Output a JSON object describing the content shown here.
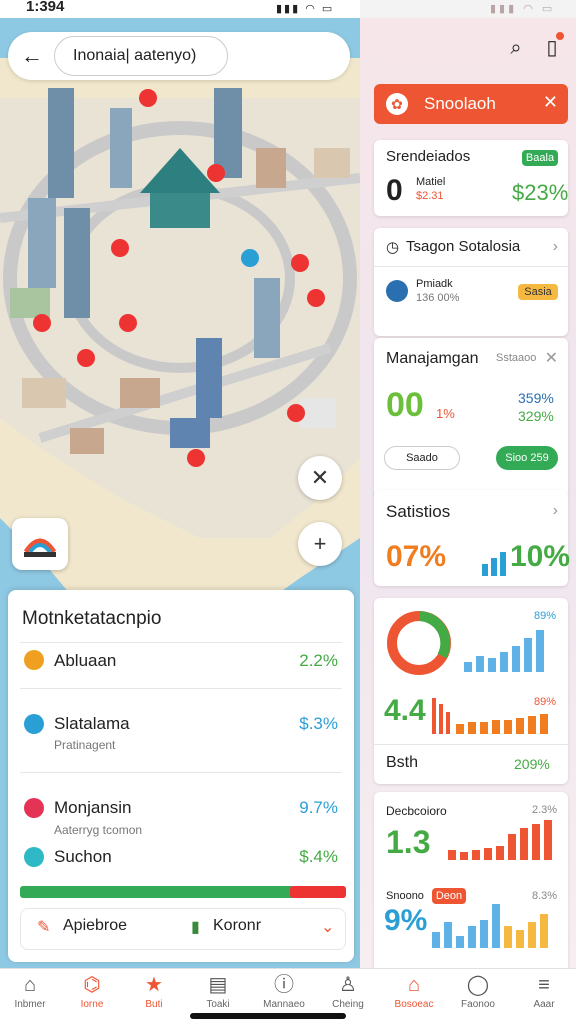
{
  "status": {
    "time": "1:394"
  },
  "search": {
    "query": "Inonaia| aatenyo)"
  },
  "sheet": {
    "title": "Motnketatacnpio",
    "rows": [
      {
        "label": "Abluaan",
        "sub": "",
        "value": "2.2%",
        "dot_color": "#f0a020",
        "value_color": "#44aa44"
      },
      {
        "label": "Slatalama",
        "sub": "Pratinagent",
        "value": "$.3%",
        "dot_color": "#2a9fd6",
        "value_color": "#2a9fd6"
      },
      {
        "label": "Monjansin",
        "sub": "Aaterryg tcomon",
        "value": "9.7%",
        "dot_color": "#e53355",
        "value_color": "#2a9fd6"
      },
      {
        "label": "Suchon",
        "sub": "",
        "value": "$.4%",
        "dot_color": "#2fb8c6",
        "value_color": "#44aa44"
      }
    ],
    "progress": 0.84,
    "footer": {
      "left": "Apiebroe",
      "right": "Koronr"
    }
  },
  "right": {
    "alert": {
      "text": "Snoolaoh"
    },
    "card1": {
      "title": "Srendeiados",
      "badge": "Baala",
      "big": "0",
      "line1": "Matiel",
      "line2": "$2.31",
      "value": "$23%"
    },
    "card2": {
      "title": "Tsagon Sotalosia",
      "l1": "Pmiadk",
      "l2": "136 00%",
      "badge": "Sasia"
    },
    "card3": {
      "title": "Manajamgan",
      "sub": "Sstaaoo",
      "big": "00",
      "pct": "1%",
      "v1": "359%",
      "v2": "329%",
      "btn1": "Saado",
      "btn2": "Sioo 259"
    },
    "card4": {
      "title": "Satistios",
      "big": "07%",
      "value": "10%"
    },
    "card5": {
      "pct": "89%",
      "big": "4.4",
      "pct2": "89%",
      "caption": "Bsth",
      "caption_val": "209%"
    },
    "card6": {
      "title": "Decbcoioro",
      "pct": "2.3%",
      "big": "1.3",
      "sub": "Snoono",
      "tag": "Deon",
      "pct2": "8.3%",
      "big2": "9%"
    }
  },
  "nav": [
    {
      "label": "Inbmer",
      "icon": "home-icon",
      "active": false
    },
    {
      "label": "Iorne",
      "icon": "bank-icon",
      "active": true
    },
    {
      "label": "Buti",
      "icon": "star-icon",
      "active": true
    },
    {
      "label": "Toaki",
      "icon": "doc-icon",
      "active": false
    },
    {
      "label": "Mannaeo",
      "icon": "info-icon",
      "active": false
    },
    {
      "label": "Cheing",
      "icon": "user-icon",
      "active": false
    },
    {
      "label": "Bosoeac",
      "icon": "tag-icon",
      "active": true
    },
    {
      "label": "Faonoo",
      "icon": "chat-icon",
      "active": false
    },
    {
      "label": "Aaar",
      "icon": "menu-icon",
      "active": false
    }
  ]
}
